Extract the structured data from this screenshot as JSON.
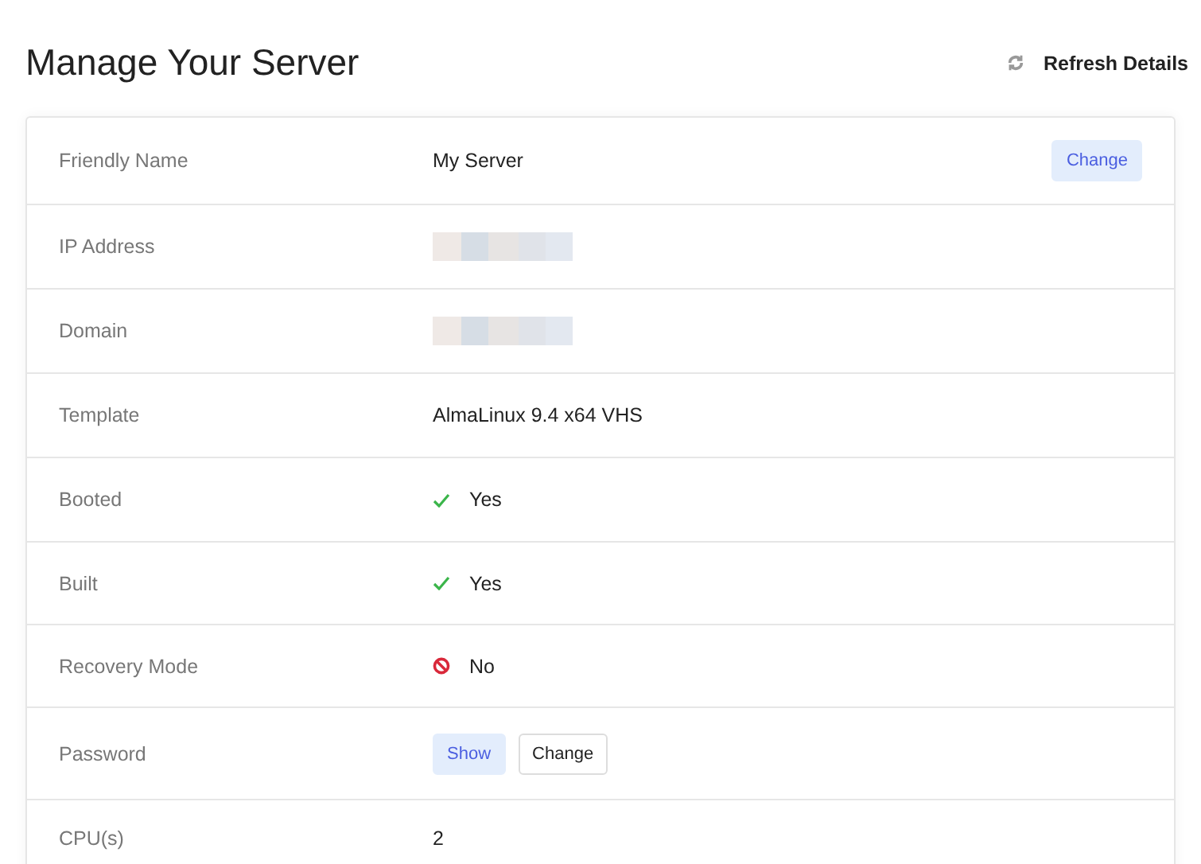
{
  "title": "Manage Your Server",
  "refresh": {
    "label": "Refresh Details"
  },
  "rows": [
    {
      "label": "Friendly Name",
      "kind": "text",
      "value": "My Server",
      "action": "Change"
    },
    {
      "label": "IP Address",
      "kind": "redacted"
    },
    {
      "label": "Domain",
      "kind": "redacted"
    },
    {
      "label": "Template",
      "kind": "text",
      "value": "AlmaLinux 9.4 x64 VHS"
    },
    {
      "label": "Booted",
      "kind": "status",
      "on": true,
      "value": "Yes"
    },
    {
      "label": "Built",
      "kind": "status",
      "on": true,
      "value": "Yes"
    },
    {
      "label": "Recovery Mode",
      "kind": "status",
      "on": false,
      "value": "No"
    },
    {
      "label": "Password",
      "kind": "buttons",
      "buttons": [
        {
          "label": "Show",
          "primary": true
        },
        {
          "label": "Change",
          "primary": false
        }
      ]
    },
    {
      "label": "CPU(s)",
      "kind": "text",
      "value": "2"
    }
  ]
}
